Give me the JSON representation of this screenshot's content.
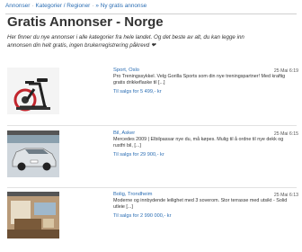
{
  "breadcrumb": {
    "home": "Annonser",
    "categories": "Kategorier / Regioner",
    "current": "» Ny gratis annonse"
  },
  "page": {
    "title": "Gratis Annonser - Norge",
    "intro": "Her finner du nye annonser i alle kategorier fra hele landet. Og det beste av alt, du kan legge inn annonsen din helt gratis, ingen brukerregistrering påkrevd ❤"
  },
  "listings": [
    {
      "location": "Sport, Oslo",
      "date": "25 Mai 6:19",
      "description": "Pro Treningssykkel. Velg Gorilla Sports som din nye treningspartner! Med kraftig gratis drikkeflaske til [...]",
      "price": "Til salgs for 5 499,- kr"
    },
    {
      "location": "Bil, Asker",
      "date": "25 Mai 6:15",
      "description": "Mercedes 2009 | Elbilpassar nye du, må køpes. Mulig til å ordne til nye dekk og rustfri bil, [...]",
      "price": "Til salgs for 29 900,- kr"
    },
    {
      "location": "Bolig, Trondheim",
      "date": "25 Mai 6:13",
      "description": "Moderne og innbydende leilighet med 3 soverom. Stor terrasse med utsikt - Solid utleie [...]",
      "price": "Til salgs for 2 990 000,- kr"
    }
  ]
}
